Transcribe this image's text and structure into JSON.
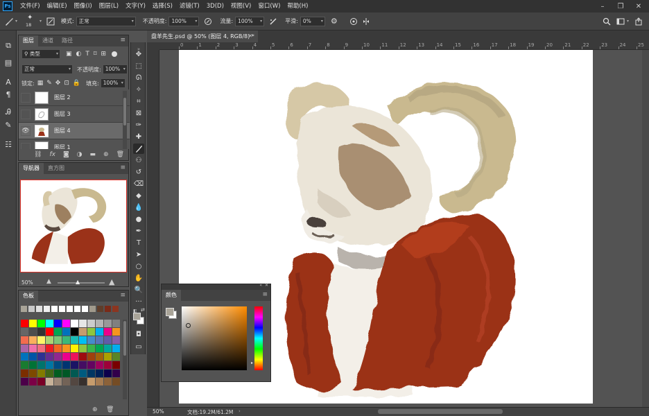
{
  "app": {
    "logo": "Ps"
  },
  "menubar": {
    "items": [
      "文件(F)",
      "编辑(E)",
      "图像(I)",
      "图层(L)",
      "文字(Y)",
      "选择(S)",
      "滤镜(T)",
      "3D(D)",
      "视图(V)",
      "窗口(W)",
      "帮助(H)"
    ],
    "window_controls": [
      "–",
      "❐",
      "✕"
    ]
  },
  "options": {
    "brush_size": "18",
    "mode_label": "模式:",
    "mode_value": "正常",
    "opacity_label": "不透明度:",
    "opacity_value": "100%",
    "flow_label": "流量:",
    "flow_value": "100%",
    "smooth_label": "平滑:",
    "smooth_value": "0%"
  },
  "document": {
    "tab_title": "盘羊先生.psd @ 50% (图层 4, RGB/8) *",
    "close": "✕"
  },
  "ruler": {
    "h_ticks": [
      "0",
      "1",
      "2",
      "3",
      "4",
      "5",
      "6",
      "7",
      "8",
      "9",
      "10",
      "11",
      "12",
      "13",
      "14",
      "15",
      "16",
      "17",
      "18",
      "19",
      "20",
      "21",
      "22",
      "23",
      "24",
      "25"
    ]
  },
  "layers_panel": {
    "tabs": [
      "图层",
      "通道",
      "路径"
    ],
    "filter_label": "类型",
    "blend_mode": "正常",
    "opacity_label": "不透明度:",
    "opacity_value": "100%",
    "lock_label": "锁定:",
    "fill_label": "填充:",
    "fill_value": "100%",
    "layers": [
      {
        "name": "图层 2",
        "visible": false,
        "selected": false
      },
      {
        "name": "图层 3",
        "visible": false,
        "selected": false
      },
      {
        "name": "图层 4",
        "visible": true,
        "selected": true
      },
      {
        "name": "图层 1",
        "visible": false,
        "selected": false
      }
    ],
    "bottom_icons": [
      "link-icon",
      "fx-icon",
      "mask-icon",
      "adjustment-icon",
      "folder-icon",
      "new-layer-icon",
      "trash-icon"
    ],
    "fx_label": "fx"
  },
  "navigator_panel": {
    "tabs": [
      "导航器",
      "直方图"
    ],
    "zoom": "50%",
    "frame_color": "#e0332b"
  },
  "swatches_panel": {
    "tabs": [
      "色板"
    ]
  },
  "color_panel": {
    "tab": "颜色",
    "fg_color": "#a9a498",
    "bg_color": "#ffffff"
  },
  "status": {
    "zoom": "50%",
    "doc_info": "文档:19.2M/61.2M"
  },
  "colors": {
    "accent": "#31a8ff",
    "coat": "#9b3219",
    "horn": "#c9b98f"
  }
}
